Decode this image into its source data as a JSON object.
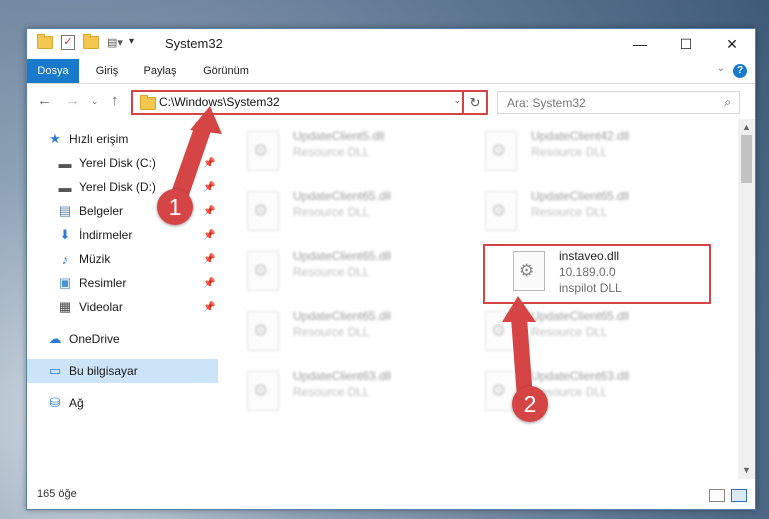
{
  "window": {
    "title": "System32",
    "controls": {
      "minimize": "—",
      "maximize": "☐",
      "close": "✕"
    }
  },
  "ribbon": {
    "tabs": [
      "Dosya",
      "Giriş",
      "Paylaş",
      "Görünüm"
    ],
    "help": "?",
    "collapse": "⌄"
  },
  "address": {
    "path": "C:\\Windows\\System32",
    "refresh": "↻",
    "dropdown": "⌄",
    "back": "←",
    "forward": "→",
    "recent": "⌄",
    "up": "↑"
  },
  "search": {
    "placeholder": "Ara: System32",
    "icon": "⌕"
  },
  "nav": {
    "items": [
      {
        "label": "Hızlı erişim",
        "icon": "★"
      },
      {
        "label": "Yerel Disk (C:)",
        "icon": "▬",
        "pin": "📌"
      },
      {
        "label": "Yerel Disk (D:)",
        "icon": "▬",
        "pin": "📌"
      },
      {
        "label": "Belgeler",
        "icon": "▤",
        "pin": "📌"
      },
      {
        "label": "İndirmeler",
        "icon": "⬇",
        "pin": "📌"
      },
      {
        "label": "Müzik",
        "icon": "♪",
        "pin": "📌"
      },
      {
        "label": "Resimler",
        "icon": "▣",
        "pin": "📌"
      },
      {
        "label": "Videolar",
        "icon": "▦",
        "pin": "📌"
      },
      {
        "label": "OneDrive",
        "icon": "☁"
      },
      {
        "label": "Bu bilgisayar",
        "icon": "▭"
      },
      {
        "label": "Ağ",
        "icon": "⛁"
      }
    ]
  },
  "files": [
    {
      "name": "UpdateClient5.dll",
      "line2": "Resource DLL"
    },
    {
      "name": "UpdateClient42.dll",
      "line2": "Resource DLL"
    },
    {
      "name": "UpdateClient65.dll",
      "line2": "Resource DLL"
    },
    {
      "name": "UpdateClient65.dll",
      "line2": "Resource DLL"
    },
    {
      "name": "UpdateClient65.dll",
      "line2": "Resource DLL"
    },
    {
      "name": "instaveo.dll",
      "line2": "10.189.0.0",
      "line3": "inspilot DLL"
    },
    {
      "name": "UpdateClient65.dll",
      "line2": "Resource DLL"
    },
    {
      "name": "UpdateClient65.dll",
      "line2": "Resource DLL"
    },
    {
      "name": "UpdateClient63.dll",
      "line2": "Resource DLL"
    },
    {
      "name": "UpdateClient63.dll",
      "line2": "Resource DLL"
    }
  ],
  "status": {
    "count": "165 öğe"
  },
  "annotations": {
    "badge1": "1",
    "badge2": "2",
    "accent": "#d64545"
  }
}
